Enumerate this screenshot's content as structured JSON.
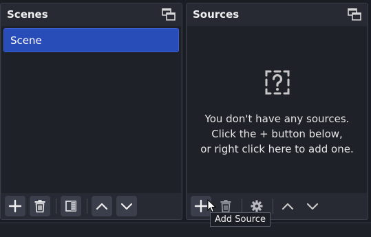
{
  "scenes": {
    "title": "Scenes",
    "items": [
      {
        "label": "Scene",
        "selected": true
      }
    ],
    "toolbar": [
      {
        "name": "add-scene-button",
        "icon": "plus-icon"
      },
      {
        "name": "remove-scene-button",
        "icon": "trash-icon"
      },
      {
        "name": "scene-filters-button",
        "icon": "filter-icon"
      },
      {
        "name": "move-scene-up-button",
        "icon": "chevron-up-icon"
      },
      {
        "name": "move-scene-down-button",
        "icon": "chevron-down-icon"
      }
    ]
  },
  "sources": {
    "title": "Sources",
    "empty": {
      "icon": "question-icon",
      "line1": "You don't have any sources.",
      "line2": "Click the + button below,",
      "line3": "or right click here to add one."
    },
    "toolbar": [
      {
        "name": "add-source-button",
        "icon": "plus-icon"
      },
      {
        "name": "remove-source-button",
        "icon": "trash-icon"
      },
      {
        "name": "source-properties-button",
        "icon": "gear-icon"
      },
      {
        "name": "move-source-up-button",
        "icon": "chevron-up-icon"
      },
      {
        "name": "move-source-down-button",
        "icon": "chevron-down-icon"
      }
    ],
    "tooltip": "Add Source"
  },
  "colors": {
    "background": "#1b1d24",
    "panel": "#272a33",
    "selected": "#284cb8",
    "text": "#e6e6e6"
  }
}
